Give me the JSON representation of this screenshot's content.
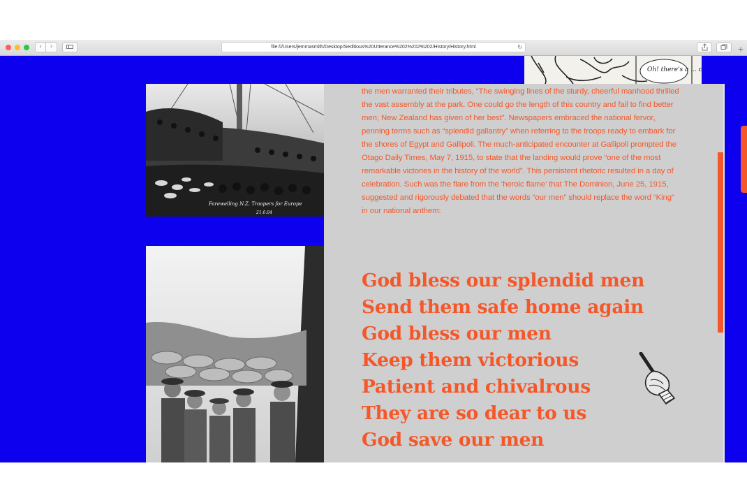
{
  "browser": {
    "url": "file:///Users/jemmasmith/Desktop/Seditious%20Utterance%202%202%202/History/History.html",
    "reload_icon": "↻",
    "new_tab_icon": "+"
  },
  "images": {
    "cartoon_caption": "Oh! there's a ... cheer",
    "photo1_caption": "Farewelling N.Z. Troopers for Europe",
    "photo1_caption_2": "21.6.04"
  },
  "article": {
    "paragraph": "the men warranted their tributes, “The swinging lines of the sturdy, cheerful manhood thrilled the vast assembly at the park. One could go the length of this country and fail to find better men; New Zealand has given of her best”. Newspapers embraced the national fervor, penning terms such as “splendid gallantry” when referring to the troops ready to embark for the shores of Egypt and Gallipoli. The much-anticipated encounter at Gallipoli prompted the Otago Daily Times, May 7, 1915, to state that the landing would prove “one of the most remarkable victories in the history of the world”. This persistent rhetoric resulted in a day of celebration. Such was the flare from the ‘heroic flame’ that The Dominion, June 25, 1915, suggested and rigorously debated that the words “our men” should replace the word “King” in our national anthem:",
    "verse": [
      "God bless our splendid men",
      "Send them safe home again",
      "God bless our men",
      "Keep them victorious",
      "Patient and chivalrous",
      "They are so dear to us",
      "God save our men"
    ]
  },
  "colors": {
    "page_background": "#0d00ef",
    "accent": "#f4582a",
    "panel": "#cfcfcf"
  }
}
